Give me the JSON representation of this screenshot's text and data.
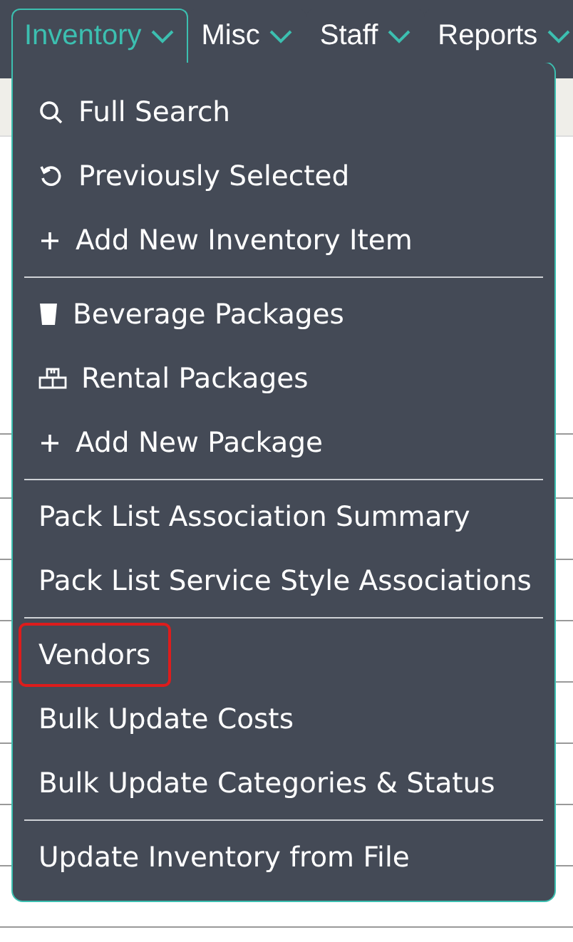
{
  "nav": {
    "tabs": [
      {
        "label": "Inventory",
        "selected": true
      },
      {
        "label": "Misc",
        "selected": false
      },
      {
        "label": "Staff",
        "selected": false
      },
      {
        "label": "Reports",
        "selected": false
      }
    ]
  },
  "menu": {
    "groups": [
      [
        {
          "label": "Full Search",
          "kind": "search",
          "outlined": false
        },
        {
          "label": "Previously Selected",
          "kind": "history",
          "outlined": false
        },
        {
          "label": "Add New Inventory Item",
          "kind": "add",
          "outlined": false
        }
      ],
      [
        {
          "label": "Beverage Packages",
          "kind": "beverage",
          "outlined": false
        },
        {
          "label": "Rental Packages",
          "kind": "rental",
          "outlined": false
        },
        {
          "label": "Add New Package",
          "kind": "add",
          "outlined": false
        }
      ],
      [
        {
          "label": "Pack List Association Summary",
          "outlined": false
        },
        {
          "label": "Pack List Service Style Associations",
          "outlined": false
        }
      ],
      [
        {
          "label": "Vendors",
          "outlined": true
        },
        {
          "label": "Bulk Update Costs",
          "outlined": false
        },
        {
          "label": "Bulk Update Categories & Status",
          "outlined": false
        }
      ],
      [
        {
          "label": "Update Inventory from File",
          "outlined": false
        }
      ]
    ]
  }
}
